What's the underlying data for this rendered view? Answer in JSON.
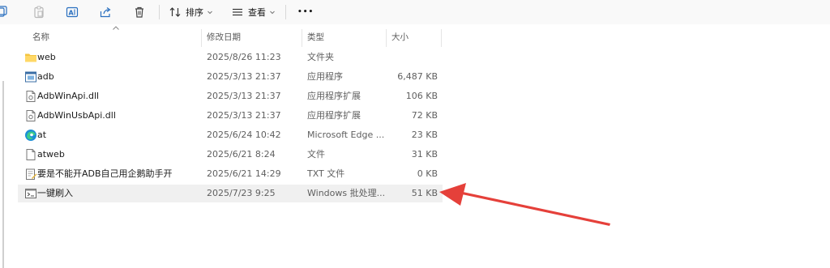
{
  "toolbar": {
    "sort_label": "排序",
    "view_label": "查看",
    "more_label": "•••"
  },
  "columns": {
    "name": "名称",
    "modified": "修改日期",
    "type": "类型",
    "size": "大小"
  },
  "files": [
    {
      "name": "web",
      "modified": "2025/8/26 11:23",
      "type": "文件夹",
      "size": "",
      "icon": "folder-icon"
    },
    {
      "name": "adb",
      "modified": "2025/3/13 21:37",
      "type": "应用程序",
      "size": "6,487 KB",
      "icon": "exe-icon"
    },
    {
      "name": "AdbWinApi.dll",
      "modified": "2025/3/13 21:37",
      "type": "应用程序扩展",
      "size": "106 KB",
      "icon": "dll-icon"
    },
    {
      "name": "AdbWinUsbApi.dll",
      "modified": "2025/3/13 21:37",
      "type": "应用程序扩展",
      "size": "72 KB",
      "icon": "dll-icon"
    },
    {
      "name": "at",
      "modified": "2025/6/24 10:42",
      "type": "Microsoft Edge ...",
      "size": "23 KB",
      "icon": "edge-icon"
    },
    {
      "name": "atweb",
      "modified": "2025/6/21 8:24",
      "type": "文件",
      "size": "31 KB",
      "icon": "file-icon"
    },
    {
      "name": "要是不能开ADB自己用企鹅助手开",
      "modified": "2025/6/21 14:29",
      "type": "TXT 文件",
      "size": "0 KB",
      "icon": "txt-icon"
    },
    {
      "name": "一键刷入",
      "modified": "2025/7/23 9:25",
      "type": "Windows 批处理...",
      "size": "51 KB",
      "icon": "bat-icon"
    }
  ],
  "colors": {
    "annotation_arrow": "#e5403a",
    "selected_row": "#f0f0f0",
    "folder": "#f4c542",
    "edge": "#1c8fd6"
  }
}
